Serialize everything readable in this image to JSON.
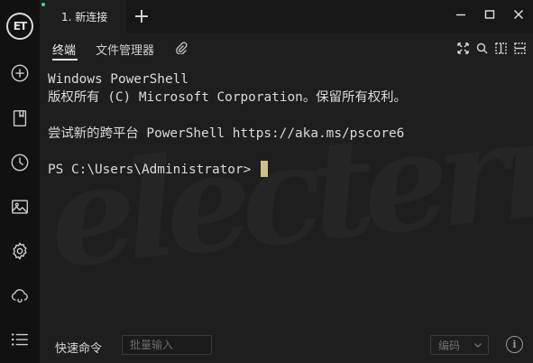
{
  "app": {
    "logo_text": "ET",
    "status_color": "#3ddc84"
  },
  "sidebar": {
    "items": [
      {
        "icon": "plus-circle-icon"
      },
      {
        "icon": "bookmark-icon"
      },
      {
        "icon": "clock-icon"
      },
      {
        "icon": "image-icon"
      },
      {
        "icon": "gear-icon"
      },
      {
        "icon": "cloud-sync-icon"
      },
      {
        "icon": "list-icon"
      }
    ]
  },
  "tabs": {
    "active_label": "1. 新连接",
    "add_label": "+"
  },
  "subtabs": {
    "terminal_label": "终端",
    "files_label": "文件管理器"
  },
  "terminal": {
    "line1": "Windows PowerShell",
    "line2": "版权所有 (C) Microsoft Corporation。保留所有权利。",
    "line3": "",
    "line4": "尝试新的跨平台 PowerShell https://aka.ms/pscore6",
    "line5": "",
    "prompt": "PS C:\\Users\\Administrator> ",
    "cursor_color": "#c9c38a",
    "watermark": "electerm"
  },
  "bottombar": {
    "quick_label": "快速命令",
    "batch_placeholder": "批量输入",
    "encoding_label": "编码",
    "info_label": "i"
  }
}
